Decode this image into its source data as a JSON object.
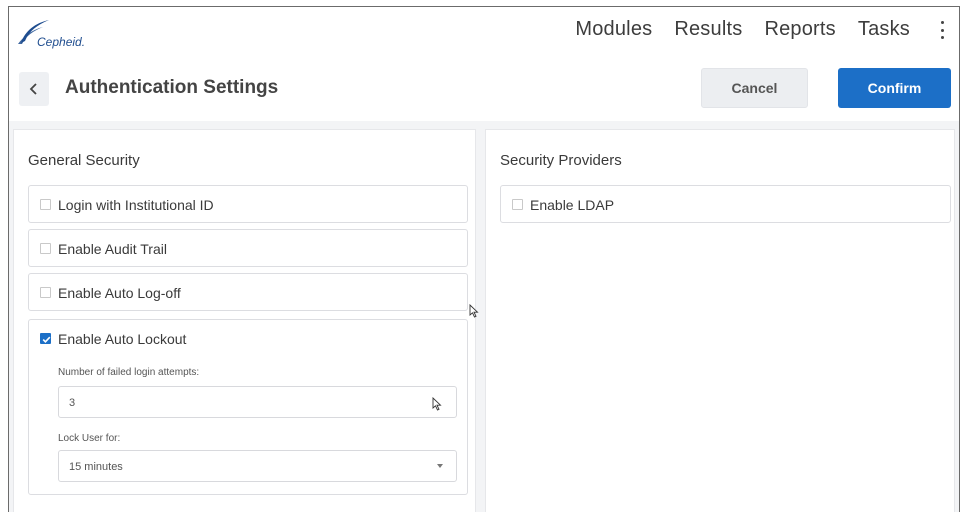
{
  "app": {
    "logo_text": "Cepheid.",
    "brand_color": "#1f4d8f"
  },
  "nav": {
    "items": [
      {
        "label": "Modules"
      },
      {
        "label": "Results"
      },
      {
        "label": "Reports"
      },
      {
        "label": "Tasks"
      }
    ],
    "menu_icon": "kebab-menu-icon"
  },
  "header": {
    "title": "Authentication Settings",
    "back_icon": "chevron-left-icon",
    "cancel_label": "Cancel",
    "confirm_label": "Confirm",
    "accent_color": "#1c6fc7"
  },
  "general_security": {
    "title": "General Security",
    "options": [
      {
        "label": "Login with Institutional ID",
        "checked": false
      },
      {
        "label": "Enable Audit Trail",
        "checked": false
      },
      {
        "label": "Enable Auto Log-off",
        "checked": false
      },
      {
        "label": "Enable Auto Lockout",
        "checked": true
      }
    ],
    "lockout": {
      "attempts_label": "Number of failed login attempts:",
      "attempts_value": "3",
      "lock_label": "Lock User for:",
      "lock_value": "15 minutes"
    }
  },
  "security_providers": {
    "title": "Security Providers",
    "options": [
      {
        "label": "Enable LDAP",
        "checked": false
      }
    ]
  }
}
